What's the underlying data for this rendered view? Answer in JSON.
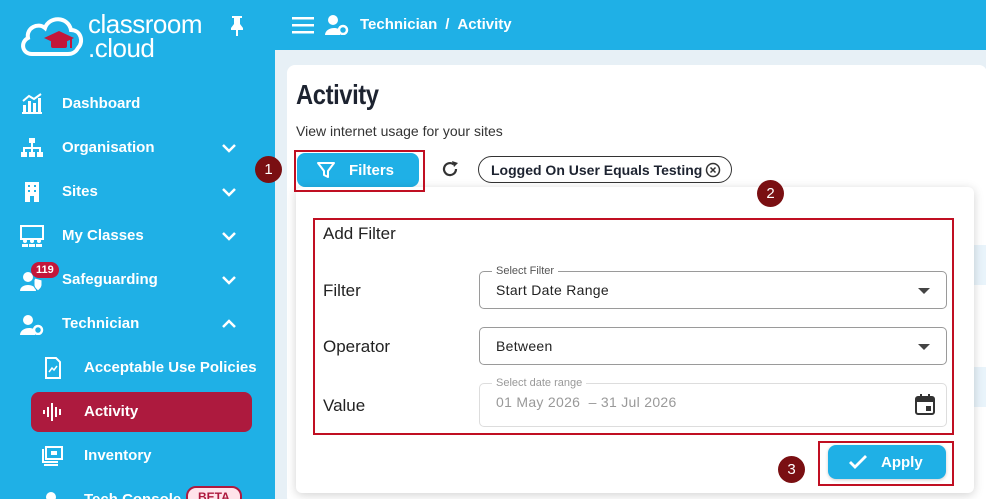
{
  "brand": {
    "line1": "classroom",
    "line2": ".cloud"
  },
  "sidebar": {
    "items": [
      {
        "label": "Dashboard",
        "icon": "chart-icon"
      },
      {
        "label": "Organisation",
        "icon": "org-icon"
      },
      {
        "label": "Sites",
        "icon": "building-icon"
      },
      {
        "label": "My Classes",
        "icon": "classroom-icon"
      },
      {
        "label": "Safeguarding",
        "icon": "safeguarding-icon",
        "badge": "119"
      },
      {
        "label": "Technician",
        "icon": "technician-icon"
      }
    ],
    "sub_items": [
      {
        "label": "Acceptable Use Policies",
        "icon": "policy-icon"
      },
      {
        "label": "Activity",
        "icon": "activity-icon",
        "active": true
      },
      {
        "label": "Inventory",
        "icon": "inventory-icon"
      },
      {
        "label": "Tech Console",
        "icon": "console-icon",
        "tag": "BETA"
      }
    ]
  },
  "topbar": {
    "crumb1": "Technician",
    "sep": "/",
    "crumb2": "Activity"
  },
  "page": {
    "title": "Activity",
    "subtitle": "View internet usage for your sites"
  },
  "toolbar": {
    "filters_label": "Filters",
    "chip_label": "Logged On User Equals Testing"
  },
  "filter_panel": {
    "title": "Add Filter",
    "filter_label": "Filter",
    "filter_float": "Select Filter",
    "filter_value": "Start Date Range",
    "operator_label": "Operator",
    "operator_value": "Between",
    "value_label": "Value",
    "value_float": "Select date range",
    "value_value": "01 May 2026  – 31 Jul 2026",
    "apply_label": "Apply"
  },
  "steps": [
    "1",
    "2",
    "3"
  ],
  "colors": {
    "brand_blue": "#1fb0e6",
    "active_red": "#ad1a3e",
    "highlight": "#c00f22"
  }
}
